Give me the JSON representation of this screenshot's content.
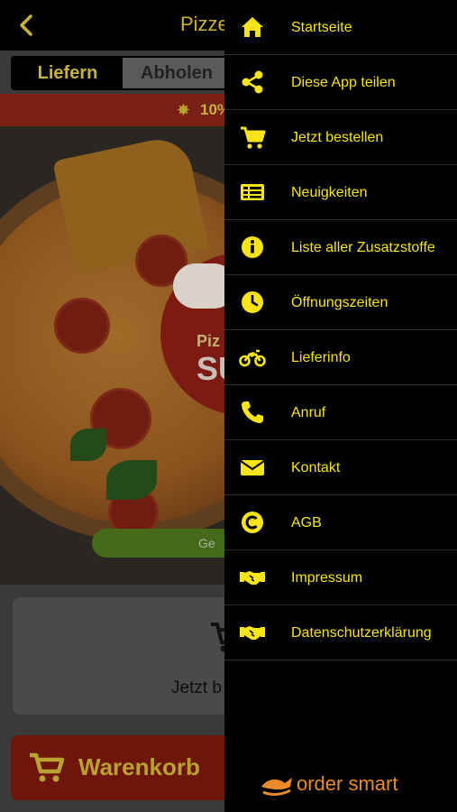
{
  "header": {
    "title": "Pizze"
  },
  "delivery_toggle": {
    "deliver_label": "Liefern",
    "pickup_label": "Abholen",
    "selected": "Liefern"
  },
  "promo": {
    "text": "10%"
  },
  "hero": {
    "badge_line1": "Piz",
    "badge_line2": "SU",
    "button_label": "Ge"
  },
  "order_card": {
    "label": "Jetzt b"
  },
  "cart_button": {
    "label": "Warenkorb"
  },
  "menu": {
    "items": [
      {
        "label": "Startseite",
        "icon": "home-icon"
      },
      {
        "label": "Diese App teilen",
        "icon": "share-icon"
      },
      {
        "label": "Jetzt bestellen",
        "icon": "cart-icon"
      },
      {
        "label": "Neuigkeiten",
        "icon": "news-icon"
      },
      {
        "label": "Liste aller Zusatzstoffe",
        "icon": "info-icon"
      },
      {
        "label": "Öffnungszeiten",
        "icon": "clock-icon"
      },
      {
        "label": "Lieferinfo",
        "icon": "motorbike-icon"
      },
      {
        "label": "Anruf",
        "icon": "phone-icon"
      },
      {
        "label": "Kontakt",
        "icon": "mail-icon"
      },
      {
        "label": "AGB",
        "icon": "copyright-icon"
      },
      {
        "label": "Impressum",
        "icon": "handshake-icon"
      },
      {
        "label": "Datenschutzerklärung",
        "icon": "handshake-icon"
      }
    ]
  },
  "brand": {
    "name": "order smart"
  },
  "colors": {
    "menu_text": "#f7e51a",
    "menu_bg": "#000000",
    "brand_orange": "#e98b2a"
  }
}
